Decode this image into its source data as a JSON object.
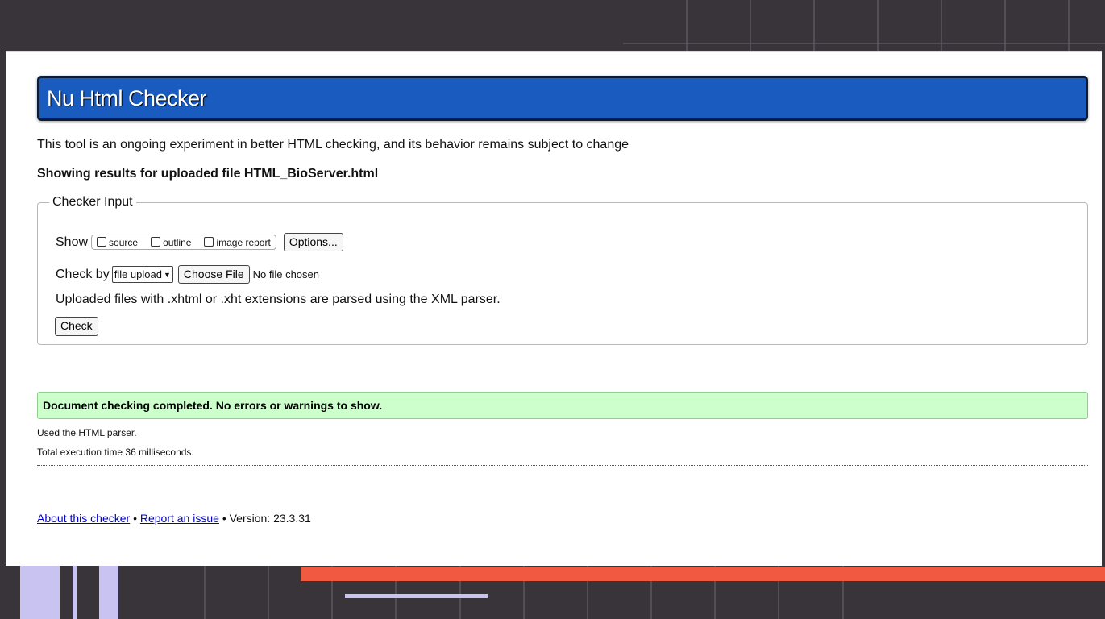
{
  "header": {
    "title": "Nu Html Checker"
  },
  "intro_text": "This tool is an ongoing experiment in better HTML checking, and its behavior remains subject to change",
  "results_heading": "Showing results for uploaded file HTML_BioServer.html",
  "checker_input": {
    "legend": "Checker Input",
    "show_label": "Show",
    "show_options": [
      {
        "label": "source",
        "checked": false
      },
      {
        "label": "outline",
        "checked": false
      },
      {
        "label": "image report",
        "checked": false
      }
    ],
    "options_button": "Options...",
    "check_by_label": "Check by",
    "check_by_value": "file upload",
    "choose_file_button": "Choose File",
    "file_status": "No file chosen",
    "note": "Uploaded files with .xhtml or .xht extensions are parsed using the XML parser.",
    "check_button": "Check"
  },
  "result": {
    "success_message": "Document checking completed. No errors or warnings to show.",
    "parser_info": "Used the HTML parser.",
    "execution_time": "Total execution time 36 milliseconds."
  },
  "footer": {
    "about_link": "About this checker",
    "separator": "•",
    "report_link": "Report an issue",
    "version": "Version: 23.3.31"
  },
  "colors": {
    "title_bar": "#1a5bbf",
    "success_bg": "#ccffcc",
    "accent_red": "#f15a40",
    "accent_lavender": "#c8c3f0",
    "frame_dark": "#38343a"
  }
}
